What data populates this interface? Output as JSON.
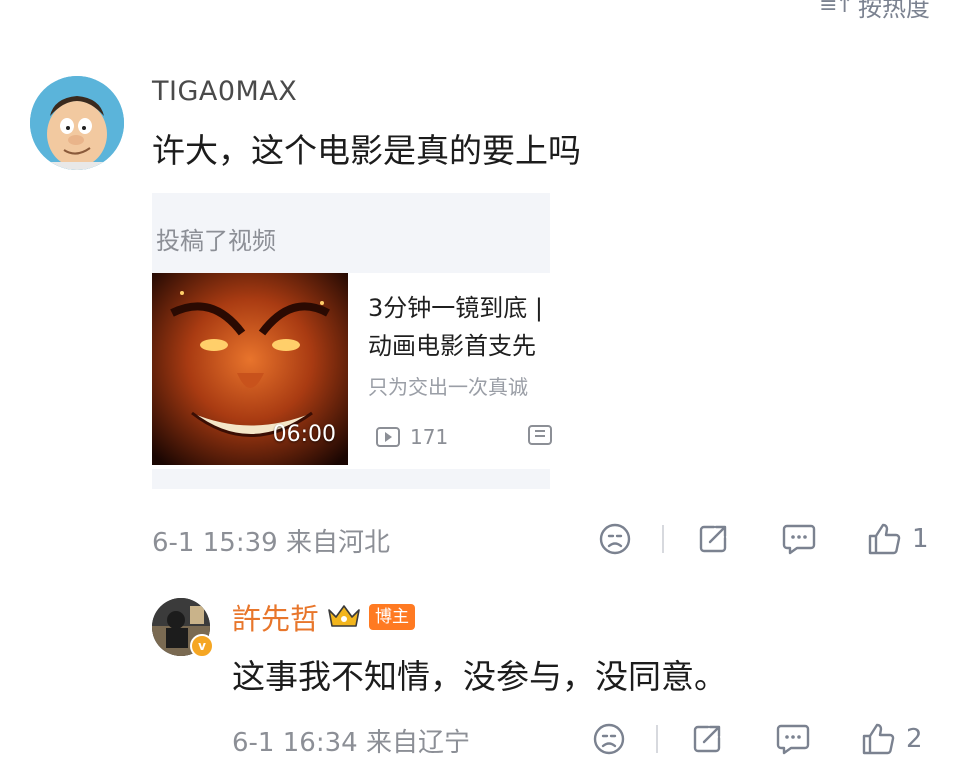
{
  "sort": {
    "label": "按热度",
    "icon": "sort-icon"
  },
  "comments": [
    {
      "username": "TIGA0MAX",
      "avatar": "cartoon-avatar",
      "text": "许大，这个电影是真的要上吗",
      "card": {
        "header": "投稿了视频",
        "duration": "06:00",
        "title_line1": "3分钟一镜到底 |",
        "title_line2": "动画电影首支先",
        "subtitle": "只为交出一次真诚",
        "views": "171"
      },
      "timestamp": "6-1 15:39",
      "location": "来自河北",
      "likes": "1"
    },
    {
      "username": "許先哲",
      "badge": "博主",
      "text": "这事我不知情，没参与，没同意。",
      "timestamp": "6-1 16:34",
      "location": "来自辽宁",
      "likes": "2"
    }
  ],
  "colors": {
    "accent_name": "#e8762b",
    "muted": "#8c8f96",
    "badge_bg": "#ff7a22"
  }
}
